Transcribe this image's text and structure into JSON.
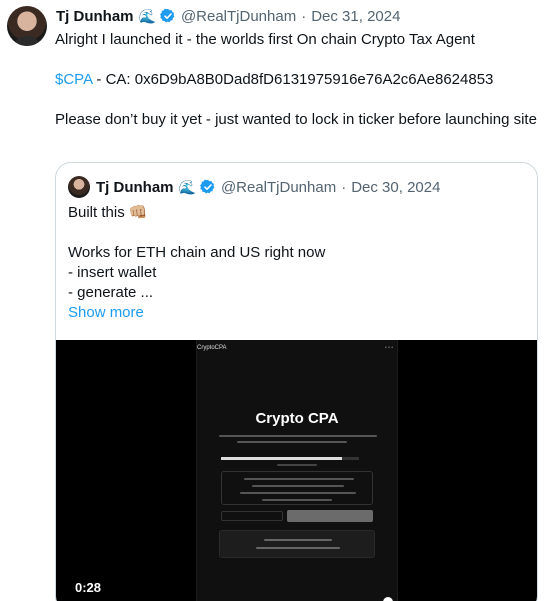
{
  "tweet": {
    "author_name": "Tj Dunham",
    "author_emoji": "🌊",
    "handle": "@RealTjDunham",
    "separator": "·",
    "date": "Dec 31, 2024",
    "line1": "Alright I launched it - the worlds first On chain Crypto Tax Agent",
    "cashtag": "$CPA",
    "ca_text": " - CA: 0x6D9bA8B0Dad8fD6131975916e76A2c6Ae8624853",
    "line3": "Please don’t buy it yet - just wanted to lock in ticker before launching site"
  },
  "quote": {
    "author_name": "Tj Dunham",
    "author_emoji": "🌊",
    "handle": "@RealTjDunham",
    "separator": "·",
    "date": "Dec 30, 2024",
    "line1": "Built this 👊🏼",
    "line2": "Works for ETH chain and US right now",
    "line3": "- insert wallet",
    "line4": "- generate ...",
    "show_more": "Show more"
  },
  "video": {
    "timestamp": "0:28",
    "screen_brand": "CryptoCPA",
    "screen_title": "Crypto CPA",
    "playback_progress": 0.68
  },
  "colors": {
    "accent": "#1d9bf0",
    "meta": "#536471",
    "border": "#cfd9de"
  },
  "icons": [
    "verified-badge-icon",
    "wave-emoji-icon"
  ]
}
